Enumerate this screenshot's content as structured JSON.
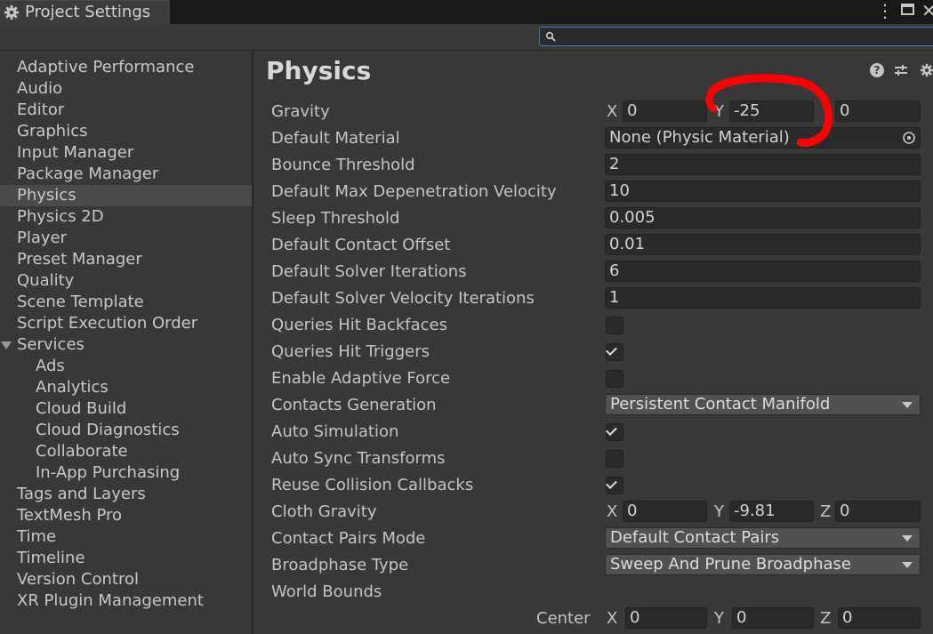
{
  "window": {
    "title": "Project Settings"
  },
  "search": {
    "value": ""
  },
  "sidebar": {
    "items": [
      {
        "label": "Adaptive Performance"
      },
      {
        "label": "Audio"
      },
      {
        "label": "Editor"
      },
      {
        "label": "Graphics"
      },
      {
        "label": "Input Manager"
      },
      {
        "label": "Package Manager"
      },
      {
        "label": "Physics",
        "selected": true
      },
      {
        "label": "Physics 2D"
      },
      {
        "label": "Player"
      },
      {
        "label": "Preset Manager"
      },
      {
        "label": "Quality"
      },
      {
        "label": "Scene Template"
      },
      {
        "label": "Script Execution Order"
      },
      {
        "label": "Services",
        "expanded": true
      },
      {
        "label": "Ads",
        "child": true
      },
      {
        "label": "Analytics",
        "child": true
      },
      {
        "label": "Cloud Build",
        "child": true
      },
      {
        "label": "Cloud Diagnostics",
        "child": true
      },
      {
        "label": "Collaborate",
        "child": true
      },
      {
        "label": "In-App Purchasing",
        "child": true
      },
      {
        "label": "Tags and Layers"
      },
      {
        "label": "TextMesh Pro"
      },
      {
        "label": "Time"
      },
      {
        "label": "Timeline"
      },
      {
        "label": "Version Control"
      },
      {
        "label": "XR Plugin Management"
      }
    ]
  },
  "physics": {
    "title": "Physics",
    "gravity": {
      "label": "Gravity",
      "x_axis": "X",
      "x": "0",
      "y_axis": "Y",
      "y": "-25",
      "z": "0"
    },
    "default_material": {
      "label": "Default Material",
      "value": "None (Physic Material)"
    },
    "bounce_threshold": {
      "label": "Bounce Threshold",
      "value": "2"
    },
    "max_depenetration": {
      "label": "Default Max Depenetration Velocity",
      "value": "10"
    },
    "sleep_threshold": {
      "label": "Sleep Threshold",
      "value": "0.005"
    },
    "contact_offset": {
      "label": "Default Contact Offset",
      "value": "0.01"
    },
    "solver_iterations": {
      "label": "Default Solver Iterations",
      "value": "6"
    },
    "solver_velocity_iterations": {
      "label": "Default Solver Velocity Iterations",
      "value": "1"
    },
    "queries_hit_backfaces": {
      "label": "Queries Hit Backfaces",
      "checked": false
    },
    "queries_hit_triggers": {
      "label": "Queries Hit Triggers",
      "checked": true
    },
    "enable_adaptive_force": {
      "label": "Enable Adaptive Force",
      "checked": false
    },
    "contacts_generation": {
      "label": "Contacts Generation",
      "value": "Persistent Contact Manifold"
    },
    "auto_simulation": {
      "label": "Auto Simulation",
      "checked": true
    },
    "auto_sync_transforms": {
      "label": "Auto Sync Transforms",
      "checked": false
    },
    "reuse_collision_callbacks": {
      "label": "Reuse Collision Callbacks",
      "checked": true
    },
    "cloth_gravity": {
      "label": "Cloth Gravity",
      "x_axis": "X",
      "x": "0",
      "y_axis": "Y",
      "y": "-9.81",
      "z_axis": "Z",
      "z": "0"
    },
    "contact_pairs_mode": {
      "label": "Contact Pairs Mode",
      "value": "Default Contact Pairs"
    },
    "broadphase_type": {
      "label": "Broadphase Type",
      "value": "Sweep And Prune Broadphase"
    },
    "world_bounds": {
      "label": "World Bounds"
    },
    "center": {
      "label": "Center",
      "x_axis": "X",
      "x": "0",
      "y_axis": "Y",
      "y": "0",
      "z_axis": "Z",
      "z": "0"
    }
  },
  "colors": {
    "panel_bg": "#383838",
    "field_bg": "#2a2a2a",
    "selection_bg": "#4a4a4a",
    "search_focus": "#3b76c9",
    "annotation_red": "#ff0000"
  }
}
